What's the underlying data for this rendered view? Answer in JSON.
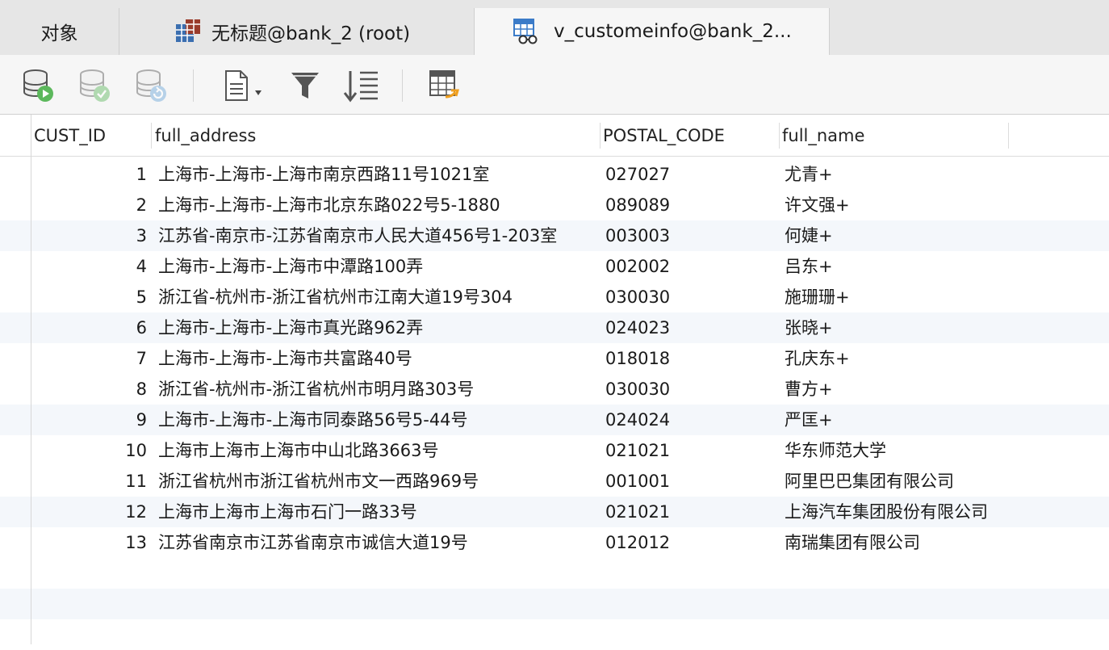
{
  "tabs": [
    {
      "label": "对象",
      "icon": "none"
    },
    {
      "label": "无标题@bank_2 (root)",
      "icon": "query-table-icon"
    },
    {
      "label": "v_customeinfo@bank_2...",
      "icon": "view-icon",
      "active": true
    }
  ],
  "toolbar": {
    "buttons": [
      "db-run-icon",
      "db-commit-icon",
      "db-refresh-icon",
      "document-menu-icon",
      "filter-icon",
      "sort-icon",
      "export-table-icon"
    ]
  },
  "colors": {
    "accent_green": "#5cb85c",
    "accent_blue": "#3b7bc8",
    "row_alt": "#f4f7fb"
  },
  "grid": {
    "columns": [
      "CUST_ID",
      "full_address",
      "POSTAL_CODE",
      "full_name"
    ],
    "rows": [
      [
        "1",
        "上海市-上海市-上海市南京西路11号1021室",
        "027027",
        "尤青+"
      ],
      [
        "2",
        "上海市-上海市-上海市北京东路022号5-1880",
        "089089",
        "许文强+"
      ],
      [
        "3",
        "江苏省-南京市-江苏省南京市人民大道456号1-203室",
        "003003",
        "何婕+"
      ],
      [
        "4",
        "上海市-上海市-上海市中潭路100弄",
        "002002",
        "吕东+"
      ],
      [
        "5",
        "浙江省-杭州市-浙江省杭州市江南大道19号304",
        "030030",
        "施珊珊+"
      ],
      [
        "6",
        "上海市-上海市-上海市真光路962弄",
        "024023",
        "张晓+"
      ],
      [
        "7",
        "上海市-上海市-上海市共富路40号",
        "018018",
        "孔庆东+"
      ],
      [
        "8",
        "浙江省-杭州市-浙江省杭州市明月路303号",
        "030030",
        "曹方+"
      ],
      [
        "9",
        "上海市-上海市-上海市同泰路56号5-44号",
        "024024",
        "严匡+"
      ],
      [
        "10",
        "上海市上海市上海市中山北路3663号",
        "021021",
        "华东师范大学"
      ],
      [
        "11",
        "浙江省杭州市浙江省杭州市文一西路969号",
        "001001",
        "阿里巴巴集团有限公司"
      ],
      [
        "12",
        "上海市上海市上海市石门一路33号",
        "021021",
        "上海汽车集团股份有限公司"
      ],
      [
        "13",
        "江苏省南京市江苏省南京市诚信大道19号",
        "012012",
        "南瑞集团有限公司"
      ]
    ]
  }
}
